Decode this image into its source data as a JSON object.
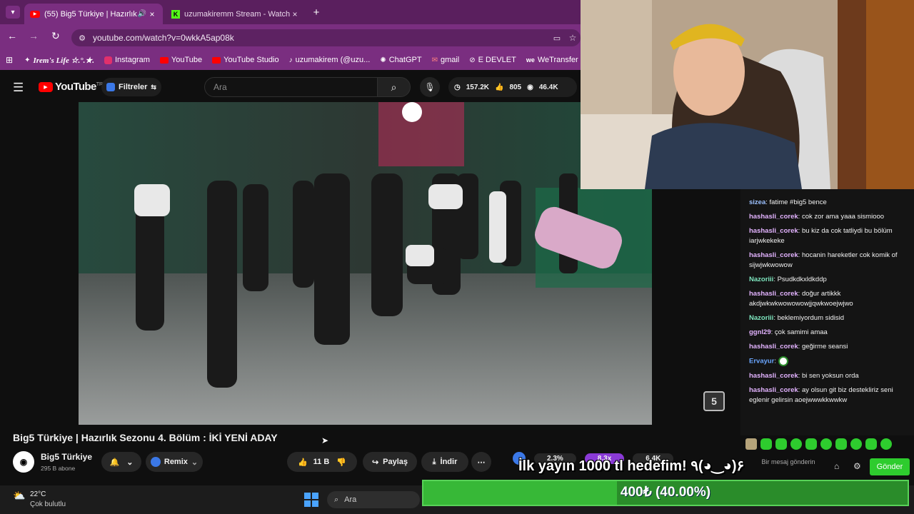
{
  "browser": {
    "tabs": [
      {
        "label": "(55) Big5 Türkiye | Hazırlık S",
        "active": true
      },
      {
        "label": "uzumakiremm Stream - Watch L",
        "active": false
      }
    ],
    "url": "youtube.com/watch?v=0wkkA5ap08k",
    "bookmarks": [
      "Irem's Life ☆.°.★.",
      "Instagram",
      "YouTube",
      "YouTube Studio",
      "uzumakirem (@uzu...",
      "ChatGPT",
      "gmail",
      "E DEVLET",
      "WeTransfer"
    ]
  },
  "youtube": {
    "logo": "YouTube",
    "logo_sup": "TR",
    "filters_label": "Filtreler",
    "search_placeholder": "Ara",
    "stats": [
      "157.2K",
      "805",
      "46.4K"
    ],
    "video_title": "Big5 Türkiye | Hazırlık Sezonu 4. Bölüm : İKİ YENİ ADAY",
    "channel_name": "Big5 Türkiye",
    "subscribers": "295 B abone",
    "remix_label": "Remix",
    "likes": "11 B",
    "share_label": "Paylaş",
    "download_label": "İndir",
    "overlay_stats": [
      "2.3%",
      "8.3x",
      "6.4K"
    ]
  },
  "chat": {
    "messages": [
      {
        "user": "sizea",
        "text": "fatime #big5 bence",
        "color": "#9cc1ff"
      },
      {
        "user": "hashasli_corek",
        "text": "cok zor ama yaaa sismiooo",
        "color": "#e3b3ff"
      },
      {
        "user": "hashasli_corek",
        "text": "bu kiz da cok tatliydi bu bölüm iarjwkekeke",
        "color": "#e3b3ff"
      },
      {
        "user": "hashasli_corek",
        "text": "hocanin hareketler cok komik of sijwjwkwowow",
        "color": "#e3b3ff"
      },
      {
        "user": "Nazoriii",
        "text": "Psudkdkxldkddp",
        "color": "#7fe8c0"
      },
      {
        "user": "hashasli_corek",
        "text": "doğur artikkk akdjwkwkwowowowjjqwkwoejwjwo",
        "color": "#e3b3ff"
      },
      {
        "user": "Nazoriii",
        "text": "beklemiyordum sidisid",
        "color": "#7fe8c0"
      },
      {
        "user": "ggnl29",
        "text": "çok samimi amaa",
        "color": "#e3b3ff"
      },
      {
        "user": "hashasli_corek",
        "text": "geğirme seansi",
        "color": "#e3b3ff"
      },
      {
        "user": "Ervayur",
        "text": "",
        "color": "#6aa6ff"
      },
      {
        "user": "hashasli_corek",
        "text": "bi sen yoksun orda",
        "color": "#e3b3ff"
      },
      {
        "user": "hashasli_corek",
        "text": "ay olsun git biz destekliriz seni eglenir gelirsin aoejwwwkkwwkw",
        "color": "#e3b3ff"
      }
    ],
    "send_label": "Gönder",
    "input_placeholder": "Bir mesaj gönderin"
  },
  "overlay": {
    "goal_text": "İlk yayın 1000 tl hedefim! ٩(◕‿◕)۶",
    "goal_progress": "400₺ (40.00%)",
    "goal_fraction": 0.4
  },
  "taskbar": {
    "temp": "22°C",
    "weather": "Çok bulutlu",
    "search_label": "Ara"
  },
  "colors": {
    "accent": "#7a2e80",
    "goal_green": "#37b837",
    "send_green": "#2ecc2e"
  }
}
